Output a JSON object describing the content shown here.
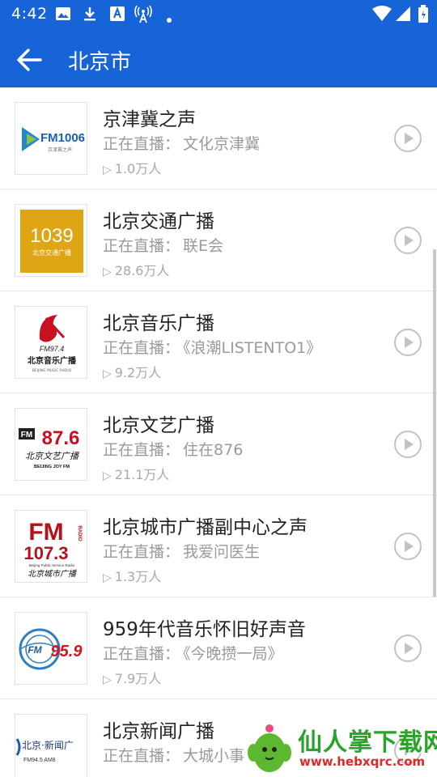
{
  "status_bar": {
    "time": "4:42",
    "icons": [
      "image-icon",
      "download-icon",
      "text-a-icon",
      "antenna-icon",
      "dot-icon",
      "wifi-icon",
      "signal-icon",
      "battery-icon"
    ]
  },
  "toolbar": {
    "title": "北京市",
    "back_icon": "arrow-back-icon",
    "background": "#1664d8"
  },
  "live_prefix": "正在直播：",
  "stations": [
    {
      "name": "京津冀之声",
      "live": "文化京津冀",
      "listeners": "1.0万人",
      "logo": "fm1006"
    },
    {
      "name": "北京交通广播",
      "live": "联E会",
      "listeners": "28.6万人",
      "logo": "1039"
    },
    {
      "name": "北京音乐广播",
      "live": "《浪潮LISTENTO1》",
      "listeners": "9.2万人",
      "logo": "fm974"
    },
    {
      "name": "北京文艺广播",
      "live": "住在876",
      "listeners": "21.1万人",
      "logo": "fm876"
    },
    {
      "name": "北京城市广播副中心之声",
      "live": "我爱问医生",
      "listeners": "1.3万人",
      "logo": "fm1073"
    },
    {
      "name": "959年代音乐怀旧好声音",
      "live": "《今晚攒一局》",
      "listeners": "7.9万人",
      "logo": "fm959"
    },
    {
      "name": "北京新闻广播",
      "live": "大城小事",
      "listeners": "",
      "logo": "news"
    }
  ],
  "logo_text": {
    "fm1006": {
      "main": "FM1006",
      "sub": "京津冀之声"
    },
    "1039": {
      "main": "1039",
      "sub": "北京交通广播"
    },
    "fm974": {
      "main": "FM97.4",
      "sub": "北京音乐广播",
      "sub2": "BEIJING MUSIC RADIO"
    },
    "fm876": {
      "tag": "FM",
      "main": "87.6",
      "sub": "北京文艺广播",
      "sub2": "BEIJING   JOY   FM"
    },
    "fm1073": {
      "main": "FM",
      "num": "107.3",
      "side": "RADIO",
      "sub": "Beijing Public Service Radio",
      "sub2": "北京城市广播"
    },
    "fm959": {
      "tag": "FM",
      "num": "95.9"
    },
    "news": {
      "main": "北京·新闻广",
      "sub": "FM94.5   AM8"
    }
  },
  "watermark": {
    "title": "仙人掌下载网",
    "url": "www.hebxqrc.com"
  }
}
